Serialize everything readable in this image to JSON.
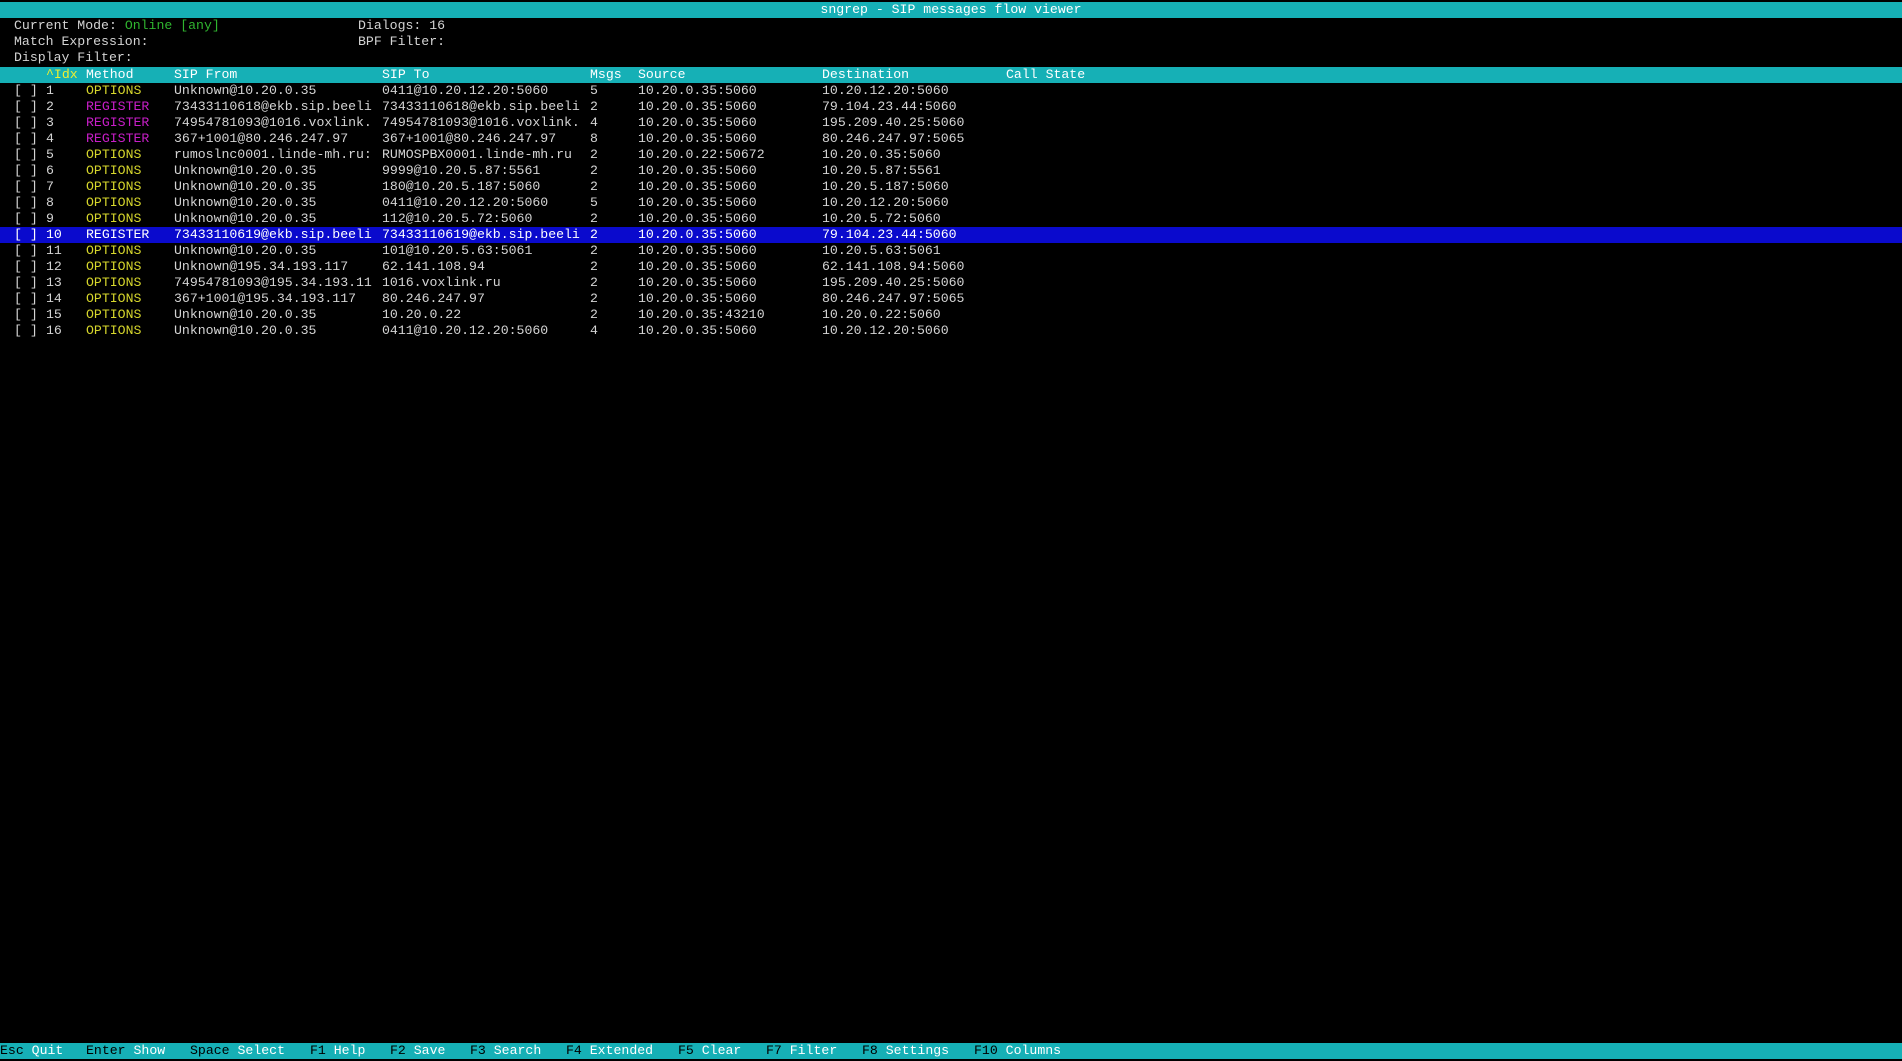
{
  "window": {
    "title": "sngrep - SIP messages flow viewer"
  },
  "header": {
    "mode_label": "Current Mode:",
    "mode_value": "Online [any]",
    "dialogs_label": "Dialogs:",
    "dialogs_value": "16",
    "match_label": "Match Expression:",
    "bpf_label": "BPF Filter:",
    "display_filter_label": "Display Filter:"
  },
  "columns": {
    "idx": "^Idx",
    "method": "Method",
    "from": "SIP From",
    "to": "SIP To",
    "msgs": "Msgs",
    "source": "Source",
    "destination": "Destination",
    "state": "Call State"
  },
  "rows": [
    {
      "check": "[ ]",
      "idx": "1",
      "method": "OPTIONS",
      "from": "Unknown@10.20.0.35",
      "to": "0411@10.20.12.20:5060",
      "msgs": "5",
      "source": "10.20.0.35:5060",
      "destination": "10.20.12.20:5060"
    },
    {
      "check": "[ ]",
      "idx": "2",
      "method": "REGISTER",
      "from": "73433110618@ekb.sip.beeli",
      "to": "73433110618@ekb.sip.beeli",
      "msgs": "2",
      "source": "10.20.0.35:5060",
      "destination": "79.104.23.44:5060"
    },
    {
      "check": "[ ]",
      "idx": "3",
      "method": "REGISTER",
      "from": "74954781093@1016.voxlink.",
      "to": "74954781093@1016.voxlink.",
      "msgs": "4",
      "source": "10.20.0.35:5060",
      "destination": "195.209.40.25:5060"
    },
    {
      "check": "[ ]",
      "idx": "4",
      "method": "REGISTER",
      "from": "367+1001@80.246.247.97",
      "to": "367+1001@80.246.247.97",
      "msgs": "8",
      "source": "10.20.0.35:5060",
      "destination": "80.246.247.97:5065"
    },
    {
      "check": "[ ]",
      "idx": "5",
      "method": "OPTIONS",
      "from": "rumoslnc0001.linde-mh.ru:",
      "to": "RUMOSPBX0001.linde-mh.ru",
      "msgs": "2",
      "source": "10.20.0.22:50672",
      "destination": "10.20.0.35:5060"
    },
    {
      "check": "[ ]",
      "idx": "6",
      "method": "OPTIONS",
      "from": "Unknown@10.20.0.35",
      "to": "9999@10.20.5.87:5561",
      "msgs": "2",
      "source": "10.20.0.35:5060",
      "destination": "10.20.5.87:5561"
    },
    {
      "check": "[ ]",
      "idx": "7",
      "method": "OPTIONS",
      "from": "Unknown@10.20.0.35",
      "to": "180@10.20.5.187:5060",
      "msgs": "2",
      "source": "10.20.0.35:5060",
      "destination": "10.20.5.187:5060"
    },
    {
      "check": "[ ]",
      "idx": "8",
      "method": "OPTIONS",
      "from": "Unknown@10.20.0.35",
      "to": "0411@10.20.12.20:5060",
      "msgs": "5",
      "source": "10.20.0.35:5060",
      "destination": "10.20.12.20:5060"
    },
    {
      "check": "[ ]",
      "idx": "9",
      "method": "OPTIONS",
      "from": "Unknown@10.20.0.35",
      "to": "112@10.20.5.72:5060",
      "msgs": "2",
      "source": "10.20.0.35:5060",
      "destination": "10.20.5.72:5060"
    },
    {
      "check": "[ ]",
      "idx": "10",
      "method": "REGISTER",
      "from": "73433110619@ekb.sip.beeli",
      "to": "73433110619@ekb.sip.beeli",
      "msgs": "2",
      "source": "10.20.0.35:5060",
      "destination": "79.104.23.44:5060",
      "selected": true
    },
    {
      "check": "[ ]",
      "idx": "11",
      "method": "OPTIONS",
      "from": "Unknown@10.20.0.35",
      "to": "101@10.20.5.63:5061",
      "msgs": "2",
      "source": "10.20.0.35:5060",
      "destination": "10.20.5.63:5061"
    },
    {
      "check": "[ ]",
      "idx": "12",
      "method": "OPTIONS",
      "from": "Unknown@195.34.193.117",
      "to": "62.141.108.94",
      "msgs": "2",
      "source": "10.20.0.35:5060",
      "destination": "62.141.108.94:5060"
    },
    {
      "check": "[ ]",
      "idx": "13",
      "method": "OPTIONS",
      "from": "74954781093@195.34.193.11",
      "to": "1016.voxlink.ru",
      "msgs": "2",
      "source": "10.20.0.35:5060",
      "destination": "195.209.40.25:5060"
    },
    {
      "check": "[ ]",
      "idx": "14",
      "method": "OPTIONS",
      "from": "367+1001@195.34.193.117",
      "to": "80.246.247.97",
      "msgs": "2",
      "source": "10.20.0.35:5060",
      "destination": "80.246.247.97:5065"
    },
    {
      "check": "[ ]",
      "idx": "15",
      "method": "OPTIONS",
      "from": "Unknown@10.20.0.35",
      "to": "10.20.0.22",
      "msgs": "2",
      "source": "10.20.0.35:43210",
      "destination": "10.20.0.22:5060"
    },
    {
      "check": "[ ]",
      "idx": "16",
      "method": "OPTIONS",
      "from": "Unknown@10.20.0.35",
      "to": "0411@10.20.12.20:5060",
      "msgs": "4",
      "source": "10.20.0.35:5060",
      "destination": "10.20.12.20:5060"
    }
  ],
  "footer": [
    {
      "key": "Esc",
      "action": "Quit"
    },
    {
      "key": "Enter",
      "action": "Show"
    },
    {
      "key": "Space",
      "action": "Select"
    },
    {
      "key": "F1",
      "action": "Help"
    },
    {
      "key": "F2",
      "action": "Save"
    },
    {
      "key": "F3",
      "action": "Search"
    },
    {
      "key": "F4",
      "action": "Extended"
    },
    {
      "key": "F5",
      "action": "Clear"
    },
    {
      "key": "F7",
      "action": "Filter"
    },
    {
      "key": "F8",
      "action": "Settings"
    },
    {
      "key": "F10",
      "action": "Columns"
    }
  ]
}
